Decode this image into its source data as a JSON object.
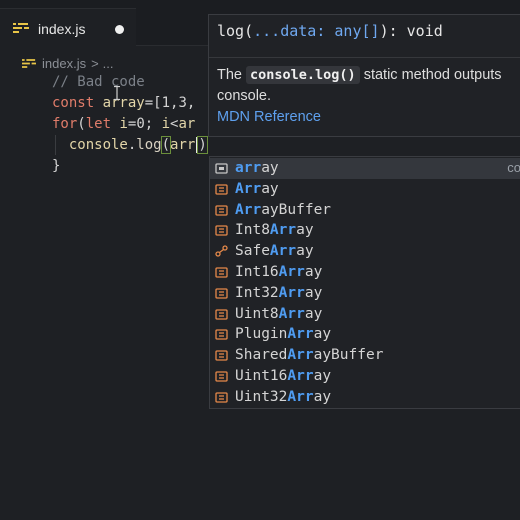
{
  "tab": {
    "filename": "index.js"
  },
  "breadcrumb": {
    "file": "index.js",
    "separator": ">",
    "rest": "..."
  },
  "editor": {
    "lines": [
      [
        {
          "t": "// Bad code",
          "c": "cm"
        }
      ],
      [
        {
          "t": "const ",
          "c": "kw"
        },
        {
          "t": "array",
          "c": "var"
        },
        {
          "t": "=[1,3,",
          "c": "pl"
        }
      ],
      [
        {
          "t": "for",
          "c": "kw"
        },
        {
          "t": "(",
          "c": "pl"
        },
        {
          "t": "let ",
          "c": "kw"
        },
        {
          "t": "i",
          "c": "var"
        },
        {
          "t": "=0; ",
          "c": "pl"
        },
        {
          "t": "i",
          "c": "var"
        },
        {
          "t": "<",
          "c": "pl"
        },
        {
          "t": "ar",
          "c": "var"
        }
      ],
      [
        {
          "t": "  console",
          "c": "var"
        },
        {
          "t": ".",
          "c": "pl"
        },
        {
          "t": "log",
          "c": "fn"
        },
        {
          "t": "(",
          "c": "pl hl-paren"
        },
        {
          "t": "arr",
          "c": "var"
        },
        {
          "t": ")",
          "c": "pl hl-paren"
        }
      ],
      [
        {
          "t": "}",
          "c": "pl"
        }
      ]
    ]
  },
  "tooltip": {
    "sig_prefix": "log(",
    "sig_dots": "...",
    "sig_mid": "data: ",
    "sig_type": "any[]",
    "sig_suffix": "): void",
    "doc_before": "The ",
    "doc_code": "console.log()",
    "doc_after": " static method outputs",
    "doc_line2": "console.",
    "link": "MDN Reference"
  },
  "suggestions": {
    "selected_detail": "co",
    "items": [
      {
        "label": "array",
        "match": [
          0,
          3
        ],
        "icon": "variable-icon"
      },
      {
        "label": "Array",
        "match": [
          0,
          3
        ],
        "icon": "class-icon"
      },
      {
        "label": "ArrayBuffer",
        "match": [
          0,
          3
        ],
        "icon": "class-icon"
      },
      {
        "label": "Int8Array",
        "match": [
          4,
          7
        ],
        "icon": "class-icon"
      },
      {
        "label": "SafeArray",
        "match": [
          4,
          7
        ],
        "icon": "interface-icon"
      },
      {
        "label": "Int16Array",
        "match": [
          5,
          8
        ],
        "icon": "class-icon"
      },
      {
        "label": "Int32Array",
        "match": [
          5,
          8
        ],
        "icon": "class-icon"
      },
      {
        "label": "Uint8Array",
        "match": [
          5,
          8
        ],
        "icon": "class-icon"
      },
      {
        "label": "PluginArray",
        "match": [
          6,
          9
        ],
        "icon": "class-icon"
      },
      {
        "label": "SharedArrayBuffer",
        "match": [
          6,
          9
        ],
        "icon": "class-icon"
      },
      {
        "label": "Uint16Array",
        "match": [
          6,
          9
        ],
        "icon": "class-icon"
      },
      {
        "label": "Uint32Array",
        "match": [
          6,
          9
        ],
        "icon": "class-icon"
      }
    ]
  },
  "colors": {
    "match": "#4f9cf1",
    "keyword": "#e07c6a",
    "variable": "#e2d5a8",
    "link": "#5ea0ee",
    "js_icon": "#e8c547"
  }
}
